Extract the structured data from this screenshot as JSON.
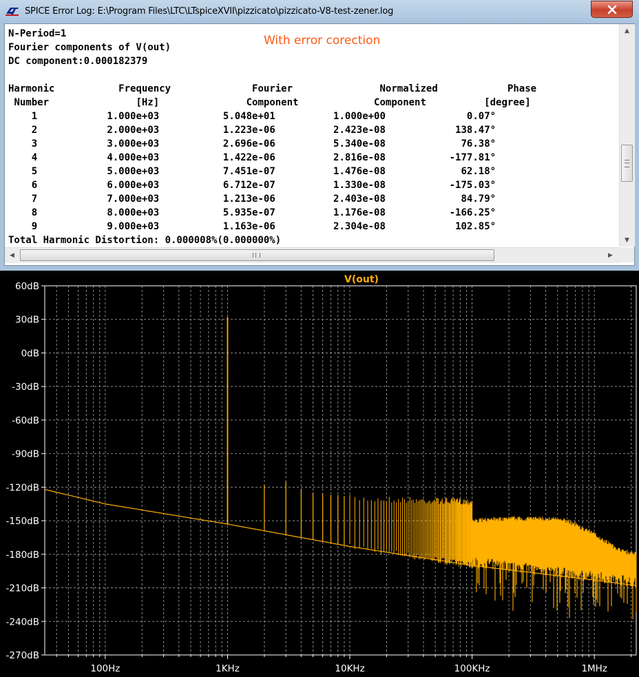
{
  "window": {
    "title": "SPICE Error Log: E:\\Program Files\\LTC\\LTspiceXVII\\pizzicato\\pizzicato-V8-test-zener.log",
    "close_icon": "close-icon",
    "annotation": "With error corection",
    "colors": {
      "annotation": "#ff5a14",
      "titlebar": "#b4cce4",
      "close": "#c8412c"
    }
  },
  "log": {
    "n_period": "N-Period=1",
    "heading": "Fourier components of V(out)",
    "dc": "DC component:0.000182379",
    "header1": [
      "Harmonic",
      "Frequency",
      "Fourier",
      "Normalized",
      "Phase"
    ],
    "header2": [
      "Number",
      "[Hz]",
      "Component",
      "Component",
      "[degree]"
    ],
    "rows": [
      [
        "1",
        "1.000e+03",
        "5.048e+01",
        "1.000e+00",
        "0.07°"
      ],
      [
        "2",
        "2.000e+03",
        "1.223e-06",
        "2.423e-08",
        "138.47°"
      ],
      [
        "3",
        "3.000e+03",
        "2.696e-06",
        "5.340e-08",
        "76.38°"
      ],
      [
        "4",
        "4.000e+03",
        "1.422e-06",
        "2.816e-08",
        "-177.81°"
      ],
      [
        "5",
        "5.000e+03",
        "7.451e-07",
        "1.476e-08",
        "62.18°"
      ],
      [
        "6",
        "6.000e+03",
        "6.712e-07",
        "1.330e-08",
        "-175.03°"
      ],
      [
        "7",
        "7.000e+03",
        "1.213e-06",
        "2.403e-08",
        "84.79°"
      ],
      [
        "8",
        "8.000e+03",
        "5.935e-07",
        "1.176e-08",
        "-166.25°"
      ],
      [
        "9",
        "9.000e+03",
        "1.163e-06",
        "2.304e-08",
        "102.85°"
      ]
    ],
    "thd": "Total Harmonic Distortion: 0.000008%(0.000000%)"
  },
  "chart_data": {
    "type": "line",
    "title": "V(out)",
    "xlabel": "",
    "ylabel": "",
    "xscale": "log",
    "xlim": [
      32,
      2200000
    ],
    "ylim": [
      -270,
      60
    ],
    "x_ticks": [
      "100Hz",
      "1KHz",
      "10KHz",
      "100KHz",
      "1MHz"
    ],
    "x_tick_values": [
      100,
      1000,
      10000,
      100000,
      1000000
    ],
    "y_ticks": [
      "60dB",
      "30dB",
      "0dB",
      "-30dB",
      "-60dB",
      "-90dB",
      "-120dB",
      "-150dB",
      "-180dB",
      "-210dB",
      "-240dB",
      "-270dB"
    ],
    "y_tick_values": [
      60,
      30,
      0,
      -30,
      -60,
      -90,
      -120,
      -150,
      -180,
      -210,
      -240,
      -270
    ],
    "grid": true,
    "colors": {
      "trace": "#ffb000",
      "background": "#000000",
      "grid": "#8c8c8c",
      "title": "#ffb000"
    },
    "series": [
      {
        "values": {
          "noise_floor": [
            [
              32,
              -122
            ],
            [
              100,
              -135
            ],
            [
              1000,
              -153
            ],
            [
              10000,
              -173
            ],
            [
              100000,
              -190
            ],
            [
              1000000,
              -203
            ],
            [
              2200000,
              -208
            ]
          ],
          "upper_envelope": [
            [
              100000,
              -150
            ],
            [
              200000,
              -148
            ],
            [
              400000,
              -148
            ],
            [
              600000,
              -150
            ],
            [
              1000000,
              -162
            ],
            [
              1600000,
              -176
            ],
            [
              2200000,
              -180
            ]
          ],
          "peaks": [
            [
              1000,
              32
            ],
            [
              2000,
              -118
            ],
            [
              3000,
              -115
            ],
            [
              4000,
              -122
            ],
            [
              5000,
              -125
            ],
            [
              6000,
              -126
            ],
            [
              7000,
              -127
            ],
            [
              8000,
              -127
            ],
            [
              9000,
              -128
            ]
          ]
        }
      }
    ]
  }
}
